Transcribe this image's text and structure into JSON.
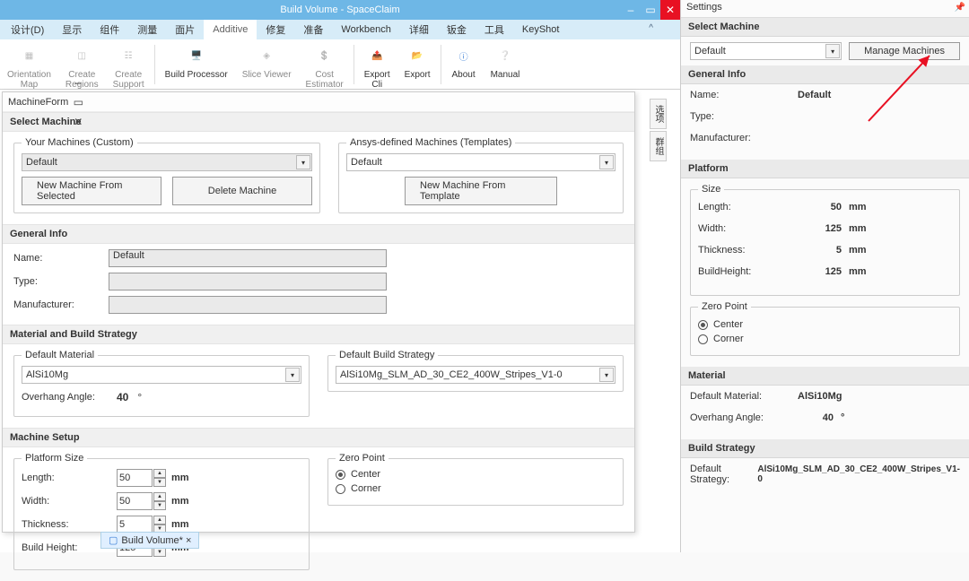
{
  "titlebar": {
    "title": "Build Volume - SpaceClaim"
  },
  "menus": {
    "items": [
      "设计(D)",
      "显示",
      "组件",
      "测量",
      "面片",
      "Additive",
      "修复",
      "准备",
      "Workbench",
      "详细",
      "钣金",
      "工具",
      "KeyShot"
    ],
    "active_index": 5
  },
  "ribbon": {
    "orientation_map": "Orientation\nMap",
    "create_regions": "Create\nRegions",
    "create_support": "Create\nSupport",
    "build_processor": "Build Processor",
    "slice_viewer": "Slice Viewer",
    "cost_estimator": "Cost\nEstimator",
    "export_cli": "Export\nCli",
    "export": "Export",
    "about": "About",
    "manual": "Manual"
  },
  "machineform": {
    "title": "MachineForm",
    "select_machine_hdr": "Select Machine",
    "your_machines_legend": "Your Machines (Custom)",
    "your_machines_value": "Default",
    "new_from_selected": "New Machine From Selected",
    "delete_machine": "Delete Machine",
    "ansys_templates_legend": "Ansys-defined Machines (Templates)",
    "ansys_templates_value": "Default",
    "new_from_template": "New Machine From Template",
    "general_info_hdr": "General Info",
    "name_label": "Name:",
    "name_value": "Default",
    "type_label": "Type:",
    "manuf_label": "Manufacturer:",
    "mat_strategy_hdr": "Material and Build Strategy",
    "default_mat_legend": "Default Material",
    "default_mat_value": "AlSi10Mg",
    "overhang_label": "Overhang Angle:",
    "overhang_value": "40",
    "overhang_unit": "°",
    "default_strategy_legend": "Default Build Strategy",
    "default_strategy_value": "AlSi10Mg_SLM_AD_30_CE2_400W_Stripes_V1-0",
    "machine_setup_hdr": "Machine Setup",
    "platform_size_legend": "Platform Size",
    "length_label": "Length:",
    "length_value": "50",
    "width_label": "Width:",
    "width_value": "50",
    "thickness_label": "Thickness:",
    "thickness_value": "5",
    "buildheight_label": "Build Height:",
    "buildheight_value": "125",
    "mm": "mm",
    "zero_point_legend": "Zero Point",
    "zp_center": "Center",
    "zp_corner": "Corner"
  },
  "side_tabs": {
    "t1": "选项",
    "t2": "群组"
  },
  "bottom_tab": {
    "label": "Build Volume* ×"
  },
  "settings": {
    "panel_title": "Settings",
    "select_machine_hdr": "Select Machine",
    "machine_value": "Default",
    "manage_btn": "Manage Machines",
    "general_info_hdr": "General Info",
    "name_label": "Name:",
    "name_value": "Default",
    "type_label": "Type:",
    "manuf_label": "Manufacturer:",
    "platform_hdr": "Platform",
    "size_legend": "Size",
    "length_label": "Length:",
    "length_value": "50",
    "width_label": "Width:",
    "width_value": "125",
    "thickness_label": "Thickness:",
    "thickness_value": "5",
    "buildheight_label": "BuildHeight:",
    "buildheight_value": "125",
    "mm": "mm",
    "zero_point_legend": "Zero Point",
    "zp_center": "Center",
    "zp_corner": "Corner",
    "material_hdr": "Material",
    "default_mat_label": "Default Material:",
    "default_mat_value": "AlSi10Mg",
    "overhang_label": "Overhang Angle:",
    "overhang_value": "40",
    "overhang_unit": "°",
    "build_strategy_hdr": "Build Strategy",
    "default_strategy_label": "Default Strategy:",
    "default_strategy_value": "AlSi10Mg_SLM_AD_30_CE2_400W_Stripes_V1-0"
  }
}
